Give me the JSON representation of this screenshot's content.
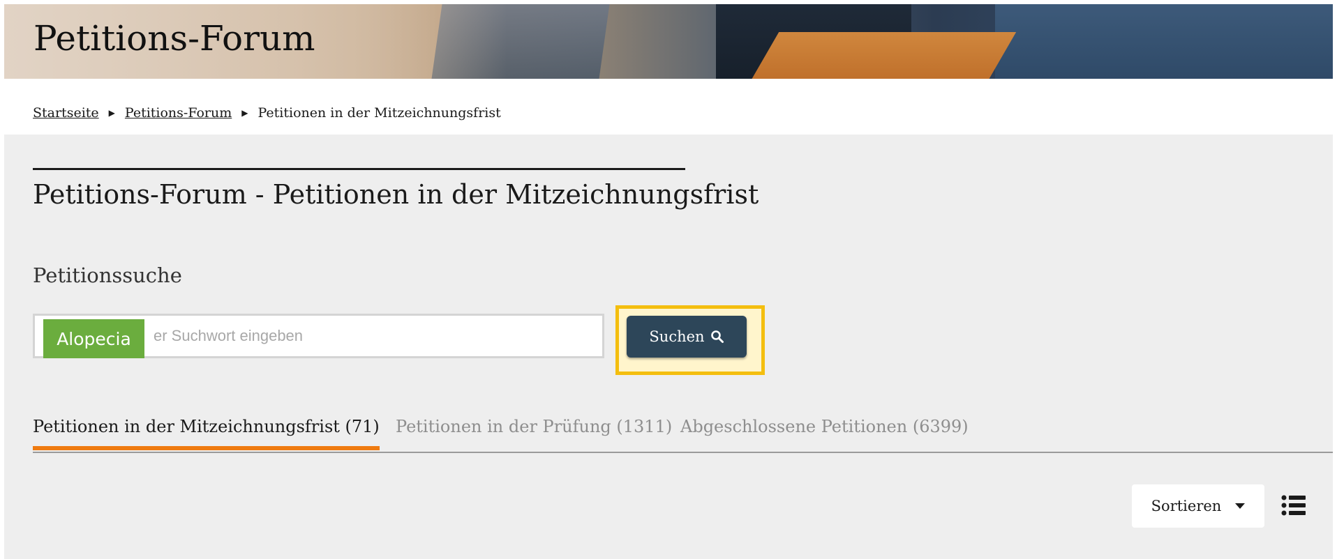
{
  "header": {
    "title": "Petitions-Forum"
  },
  "breadcrumb": {
    "items": [
      "Startseite",
      "Petitions-Forum"
    ],
    "current": "Petitionen in der Mitzeichnungsfrist"
  },
  "main": {
    "title": "Petitions-Forum - Petitionen in der Mitzeichnungsfrist",
    "search": {
      "heading": "Petitionssuche",
      "tag": "Alopecia",
      "placeholder": "er Suchwort eingeben",
      "button_label": "Suchen",
      "button_icon": "search-icon",
      "highlight_color": "#f4be0e"
    },
    "tabs": [
      {
        "label": "Petitionen in der Mitzeichnungsfrist (71)",
        "active": true
      },
      {
        "label": "Petitionen in der Prüfung (1311)",
        "active": false
      },
      {
        "label": "Abgeschlossene Petitionen (6399)",
        "active": false
      }
    ],
    "sort": {
      "label": "Sortieren",
      "icon": "caret-down-icon"
    },
    "view_toggle_icon": "list-icon"
  },
  "colors": {
    "tab_active_underline": "#ef7b10",
    "tag_background": "#6bad3e",
    "search_button": "#2d4659",
    "content_background": "#eeeeee"
  }
}
